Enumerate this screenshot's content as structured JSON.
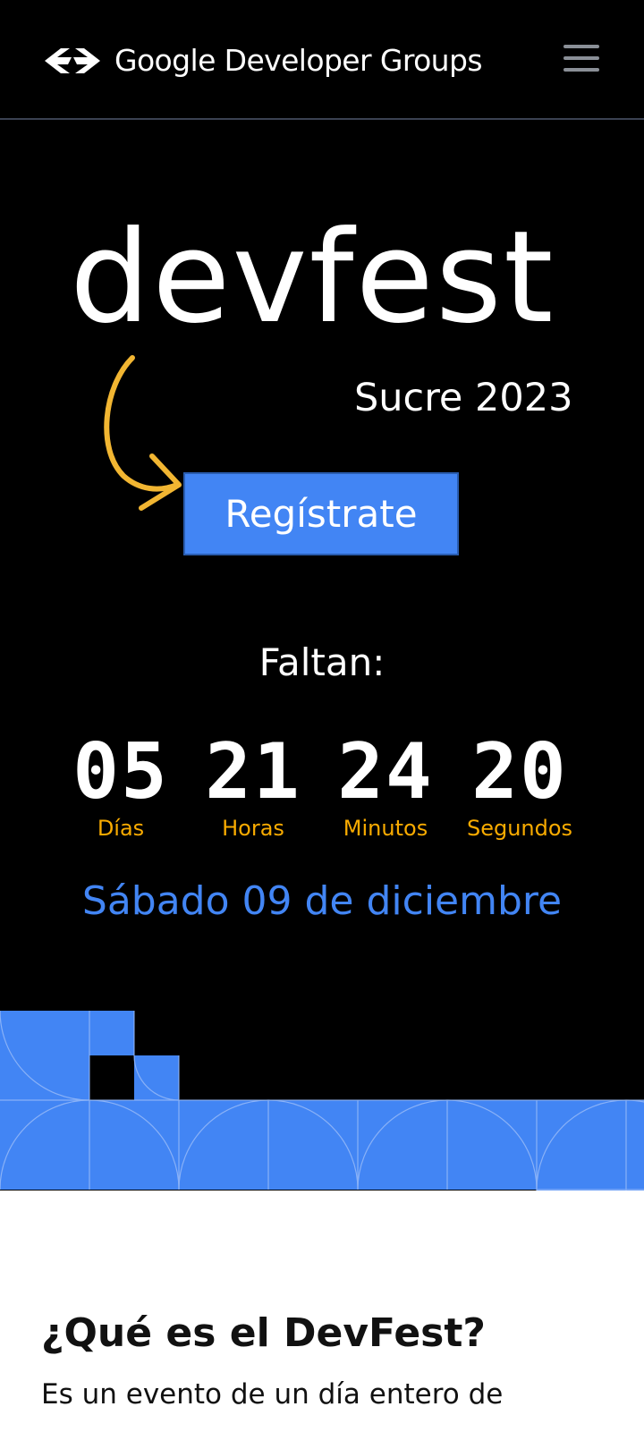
{
  "header": {
    "brand": "Google Developer Groups",
    "logo_icon": "gdg-logo-icon",
    "menu_icon": "hamburger-menu-icon"
  },
  "hero": {
    "title": "devfest",
    "subtitle": "Sucre 2023",
    "arrow_icon": "curved-arrow-icon",
    "register_label": "Regístrate"
  },
  "countdown": {
    "heading": "Faltan:",
    "units": [
      {
        "value": "05",
        "label": "Días"
      },
      {
        "value": "21",
        "label": "Horas"
      },
      {
        "value": "24",
        "label": "Minutos"
      },
      {
        "value": "20",
        "label": "Segundos"
      }
    ]
  },
  "event_date": "Sábado 09 de diciembre",
  "about": {
    "title": "¿Qué es el DevFest?",
    "text": "Es un evento de un día entero de"
  },
  "colors": {
    "background": "#000000",
    "accent_blue": "#4285f4",
    "accent_yellow": "#f9ab00",
    "arrow_yellow": "#f2b632",
    "text": "#ffffff"
  }
}
